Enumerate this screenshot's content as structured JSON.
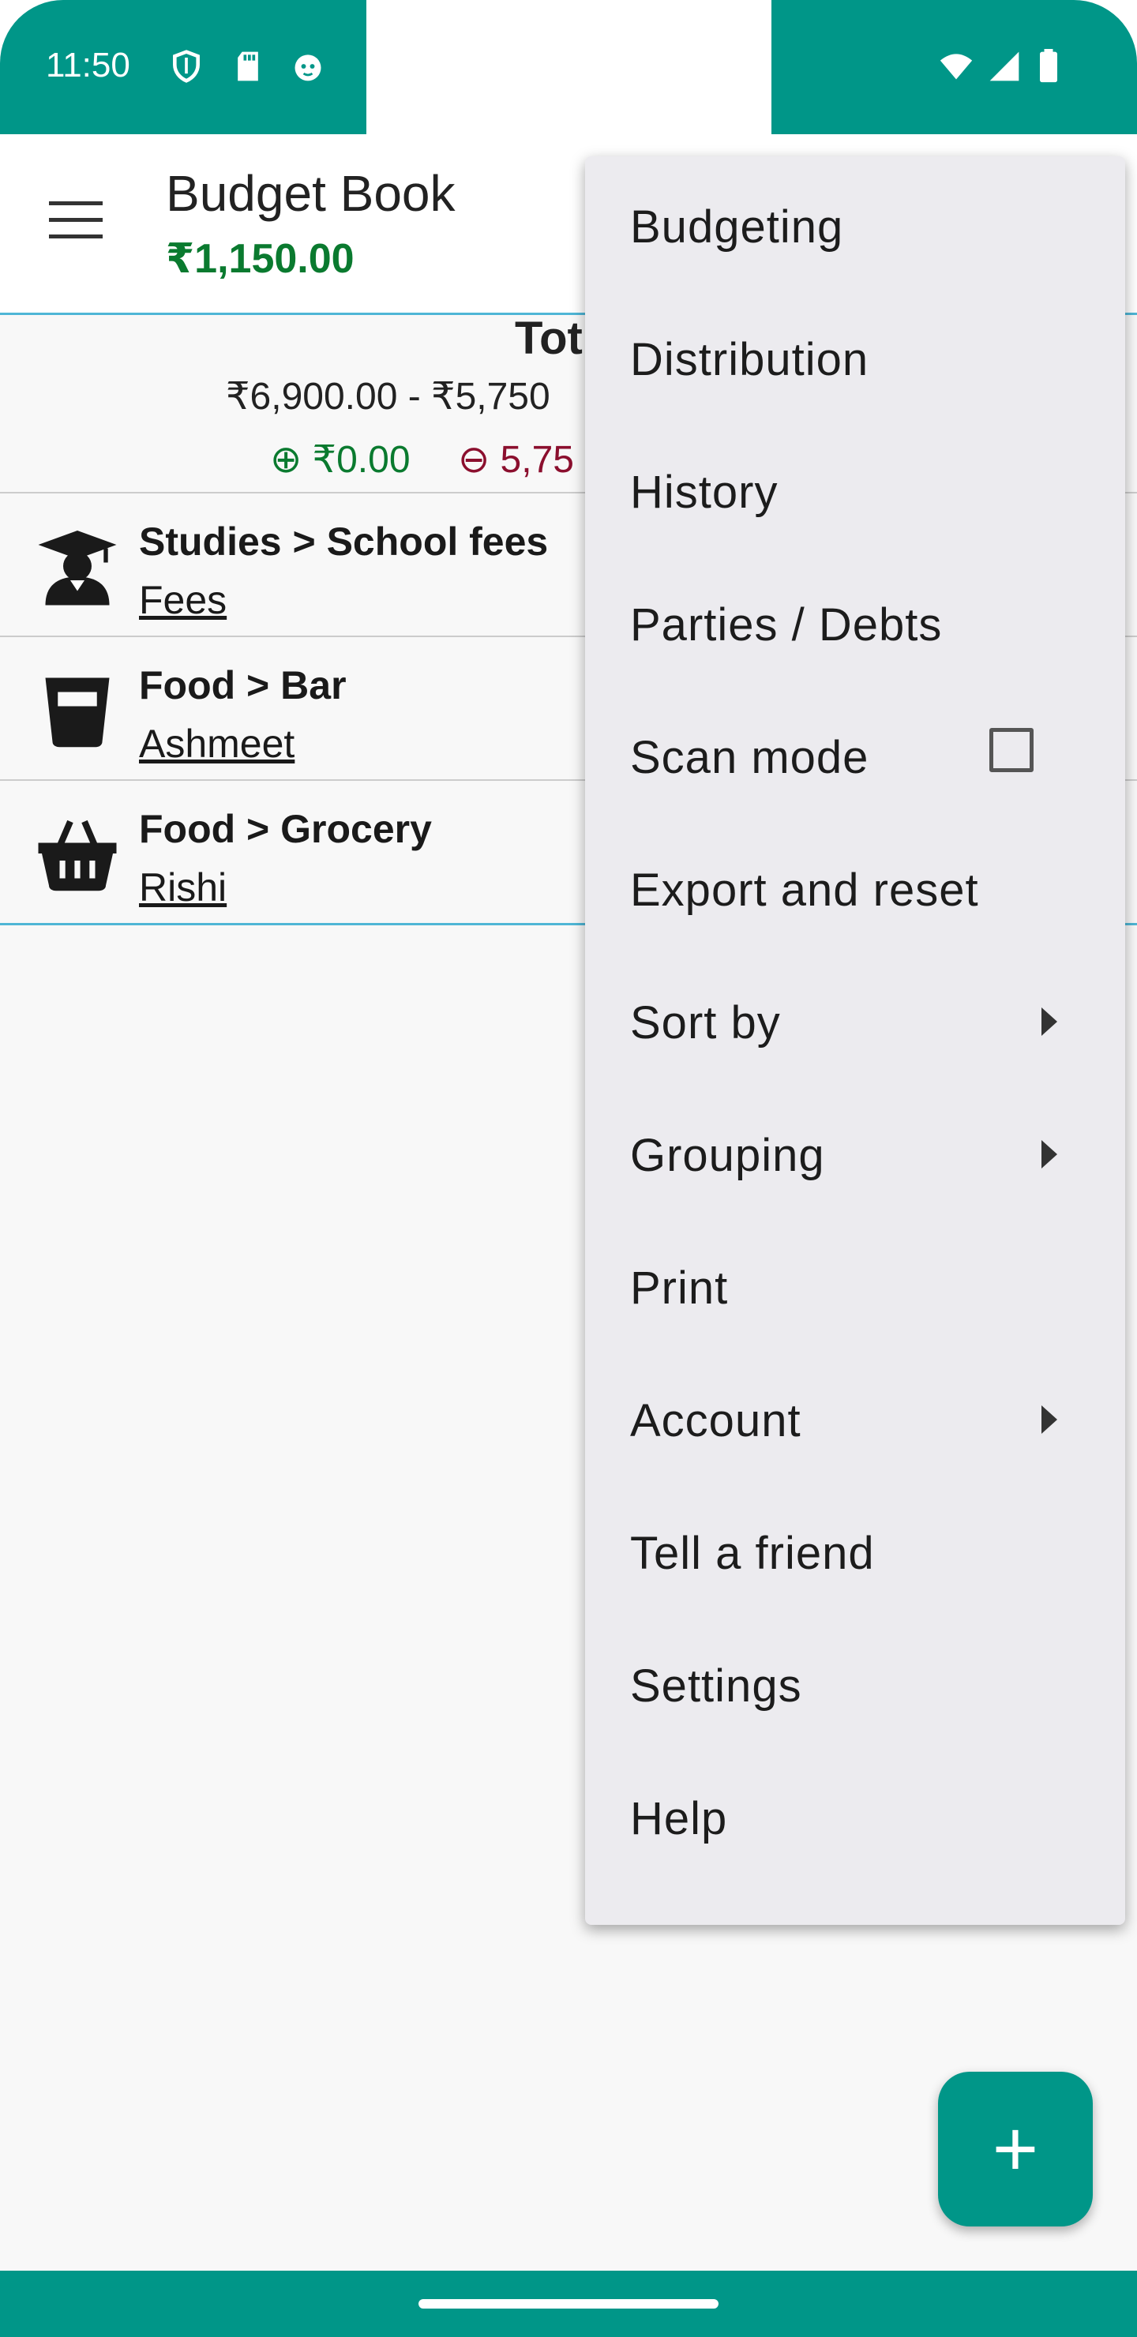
{
  "status_bar": {
    "time": "11:50",
    "icons_left": [
      "shield-icon",
      "sd-card-icon",
      "cat-face-icon"
    ],
    "icons_right": [
      "wifi-icon",
      "signal-icon",
      "battery-icon"
    ],
    "color": "#009688"
  },
  "app_bar": {
    "title": "Budget Book",
    "balance": "₹1,150.00",
    "balance_color": "#0a7a2f"
  },
  "summary": {
    "title": "Tot",
    "amounts": "₹6,900.00  - ₹5,750",
    "income": "⊕ ₹0.00",
    "expense": "⊖ 5,75"
  },
  "transactions": [
    {
      "category": "Studies > School fees",
      "party": "Fees",
      "icon": "graduate-icon"
    },
    {
      "category": "Food > Bar",
      "party": "Ashmeet",
      "icon": "glass-icon"
    },
    {
      "category": "Food > Grocery",
      "party": "Rishi",
      "icon": "basket-icon"
    }
  ],
  "menu": {
    "items": [
      {
        "label": "Budgeting"
      },
      {
        "label": "Distribution"
      },
      {
        "label": "History"
      },
      {
        "label": "Parties / Debts"
      },
      {
        "label": "Scan mode",
        "checkbox": false
      },
      {
        "label": "Export and reset"
      },
      {
        "label": "Sort by",
        "submenu": true
      },
      {
        "label": "Grouping",
        "submenu": true
      },
      {
        "label": "Print"
      },
      {
        "label": "Account",
        "submenu": true
      },
      {
        "label": "Tell a friend"
      },
      {
        "label": "Settings"
      },
      {
        "label": "Help"
      }
    ]
  },
  "fab": {
    "label": "+"
  }
}
